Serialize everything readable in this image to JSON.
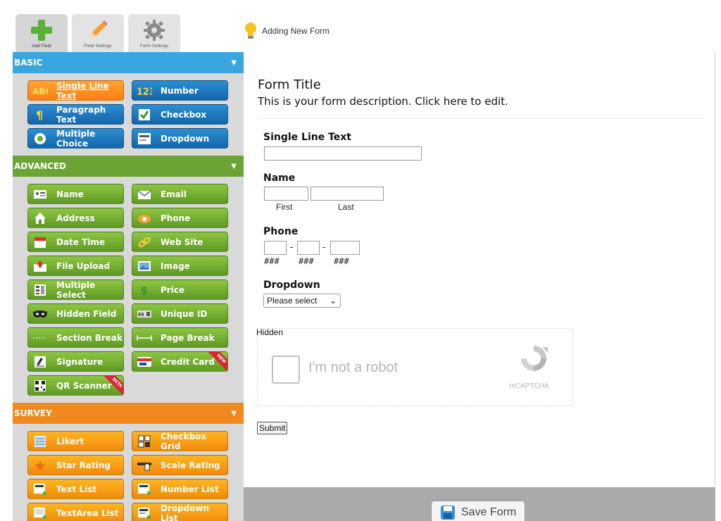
{
  "top_tabs": [
    {
      "label": "Add Field",
      "icon": "plus-icon",
      "active": true
    },
    {
      "label": "Field Settings",
      "icon": "pencil-icon",
      "active": false
    },
    {
      "label": "Form Settings",
      "icon": "gear-icon",
      "active": false
    }
  ],
  "status": {
    "icon": "lightbulb-icon",
    "text": "Adding New Form"
  },
  "sidebar": {
    "basic": {
      "title": "BASIC",
      "buttons": [
        {
          "label": "Single Line Text",
          "icon": "abc-icon"
        },
        {
          "label": "Number",
          "icon": "number-icon"
        },
        {
          "label": "Paragraph Text",
          "icon": "paragraph-icon"
        },
        {
          "label": "Checkbox",
          "icon": "checkbox-icon"
        },
        {
          "label": "Multiple Choice",
          "icon": "radio-icon"
        },
        {
          "label": "Dropdown",
          "icon": "dropdown-icon"
        }
      ]
    },
    "advanced": {
      "title": "ADVANCED",
      "buttons": [
        {
          "label": "Name",
          "icon": "name-card-icon"
        },
        {
          "label": "Email",
          "icon": "email-icon"
        },
        {
          "label": "Address",
          "icon": "house-icon"
        },
        {
          "label": "Phone",
          "icon": "phone-icon"
        },
        {
          "label": "Date Time",
          "icon": "calendar-icon"
        },
        {
          "label": "Web Site",
          "icon": "link-icon"
        },
        {
          "label": "File Upload",
          "icon": "upload-icon"
        },
        {
          "label": "Image",
          "icon": "image-icon"
        },
        {
          "label": "Multiple Select",
          "icon": "multi-select-icon"
        },
        {
          "label": "Price",
          "icon": "dollar-icon"
        },
        {
          "label": "Hidden Field",
          "icon": "mask-icon"
        },
        {
          "label": "Unique ID",
          "icon": "unique-id-icon"
        },
        {
          "label": "Section Break",
          "icon": "section-break-icon"
        },
        {
          "label": "Page Break",
          "icon": "page-break-icon"
        },
        {
          "label": "Signature",
          "icon": "signature-icon"
        },
        {
          "label": "Credit Card",
          "icon": "credit-card-icon",
          "badge": "NEW"
        },
        {
          "label": "QR Scanner",
          "icon": "qr-code-icon",
          "badge": "BETA"
        }
      ]
    },
    "survey": {
      "title": "SURVEY",
      "buttons": [
        {
          "label": "Likert",
          "icon": "likert-icon"
        },
        {
          "label": "Checkbox Grid",
          "icon": "grid-icon"
        },
        {
          "label": "Star Rating",
          "icon": "star-icon"
        },
        {
          "label": "Scale Rating",
          "icon": "scale-icon"
        },
        {
          "label": "Text List",
          "icon": "text-list-icon"
        },
        {
          "label": "Number List",
          "icon": "number-list-icon"
        },
        {
          "label": "TextArea List",
          "icon": "textarea-list-icon"
        },
        {
          "label": "Dropdown List",
          "icon": "dropdown-list-icon"
        }
      ]
    }
  },
  "form": {
    "title": "Form Title",
    "description": "This is your form description. Click here to edit.",
    "fields": {
      "single_line": {
        "label": "Single Line Text"
      },
      "name": {
        "label": "Name",
        "first": "First",
        "last": "Last"
      },
      "phone": {
        "label": "Phone",
        "dash": "-",
        "mask": "###"
      },
      "dropdown": {
        "label": "Dropdown",
        "selected": "Please select"
      }
    },
    "hidden_label": "Hidden",
    "captcha": {
      "text": "I'm not a robot",
      "brand": "reCAPTCHA"
    },
    "submit_label": "Submit"
  },
  "footer": {
    "save_label": "Save Form"
  },
  "colors": {
    "basic": "#3aa6e0",
    "advanced": "#6ba334",
    "survey": "#f2891e",
    "selected": "#ff8c1a"
  }
}
